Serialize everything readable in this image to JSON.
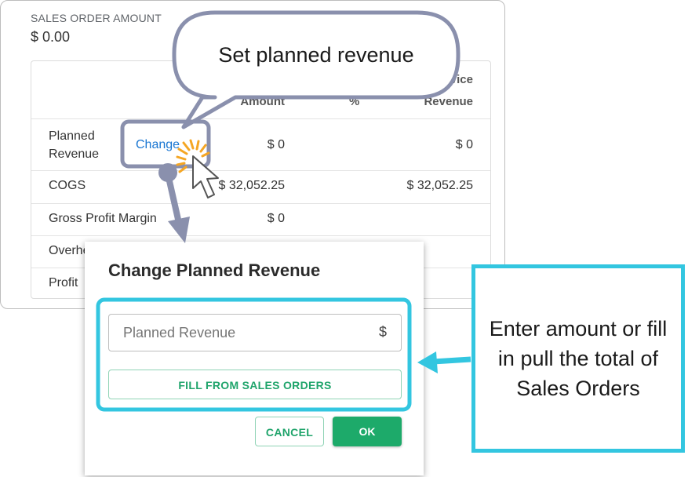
{
  "summary": {
    "label": "SALES ORDER AMOUNT",
    "value": "$ 0.00"
  },
  "table": {
    "header_top_right": "vice",
    "headers": {
      "amount": "Amount",
      "percent": "%",
      "revenue": "Revenue"
    },
    "rows": [
      {
        "label_line1": "Planned",
        "label_line2": "Revenue",
        "link": "Change",
        "amount": "$ 0",
        "revenue": "$ 0"
      },
      {
        "label": "COGS",
        "amount": "$ 32,052.25",
        "revenue": "$ 32,052.25"
      },
      {
        "label": "Gross Profit Margin",
        "amount": "$ 0"
      },
      {
        "label": "Overhe"
      },
      {
        "label": "Profit"
      }
    ]
  },
  "dialog": {
    "title": "Change Planned Revenue",
    "input_placeholder": "Planned Revenue",
    "input_value": "",
    "currency_symbol": "$",
    "fill_button": "FILL FROM SALES ORDERS",
    "cancel_button": "CANCEL",
    "ok_button": "OK"
  },
  "annotations": {
    "callout": "Set planned revenue",
    "note": "Enter amount or fill in pull the total of Sales Orders",
    "colors": {
      "callout_border": "#8a90ad",
      "highlight": "#33c6e0",
      "sparkle": "#f5a623"
    }
  },
  "icons": {
    "cursor": "arrow-cursor-icon",
    "click": "click-sparkle-icon"
  }
}
